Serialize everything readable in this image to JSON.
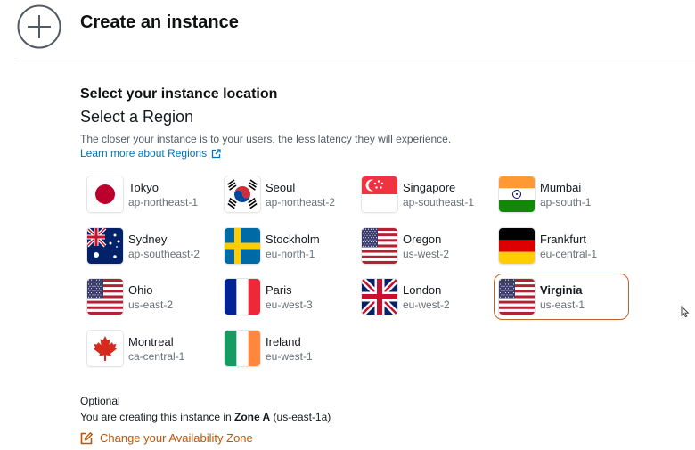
{
  "header": {
    "title": "Create an instance"
  },
  "location": {
    "heading": "Select your instance location",
    "subheading": "Select a Region",
    "description": "The closer your instance is to your users, the less latency they will experience.",
    "learn_more": "Learn more about Regions"
  },
  "regions": [
    {
      "name": "Tokyo",
      "code": "ap-northeast-1",
      "flag": "japan-flag-icon",
      "selected": false
    },
    {
      "name": "Seoul",
      "code": "ap-northeast-2",
      "flag": "south-korea-flag-icon",
      "selected": false
    },
    {
      "name": "Singapore",
      "code": "ap-southeast-1",
      "flag": "singapore-flag-icon",
      "selected": false
    },
    {
      "name": "Mumbai",
      "code": "ap-south-1",
      "flag": "india-flag-icon",
      "selected": false
    },
    {
      "name": "Sydney",
      "code": "ap-southeast-2",
      "flag": "australia-flag-icon",
      "selected": false
    },
    {
      "name": "Stockholm",
      "code": "eu-north-1",
      "flag": "sweden-flag-icon",
      "selected": false
    },
    {
      "name": "Oregon",
      "code": "us-west-2",
      "flag": "usa-flag-icon",
      "selected": false
    },
    {
      "name": "Frankfurt",
      "code": "eu-central-1",
      "flag": "germany-flag-icon",
      "selected": false
    },
    {
      "name": "Ohio",
      "code": "us-east-2",
      "flag": "usa-flag-icon",
      "selected": false
    },
    {
      "name": "Paris",
      "code": "eu-west-3",
      "flag": "france-flag-icon",
      "selected": false
    },
    {
      "name": "London",
      "code": "eu-west-2",
      "flag": "uk-flag-icon",
      "selected": false
    },
    {
      "name": "Virginia",
      "code": "us-east-1",
      "flag": "usa-flag-icon",
      "selected": true
    },
    {
      "name": "Montreal",
      "code": "ca-central-1",
      "flag": "canada-flag-icon",
      "selected": false
    },
    {
      "name": "Ireland",
      "code": "eu-west-1",
      "flag": "ireland-flag-icon",
      "selected": false
    }
  ],
  "zone": {
    "optional": "Optional",
    "prefix": "You are creating this instance in ",
    "zone_name": "Zone A",
    "suffix": " (us-east-1a)",
    "change_link": "Change your Availability Zone"
  },
  "colors": {
    "selected_border": "#c2622f",
    "link_blue": "#0073bb",
    "link_orange": "#c45500"
  }
}
